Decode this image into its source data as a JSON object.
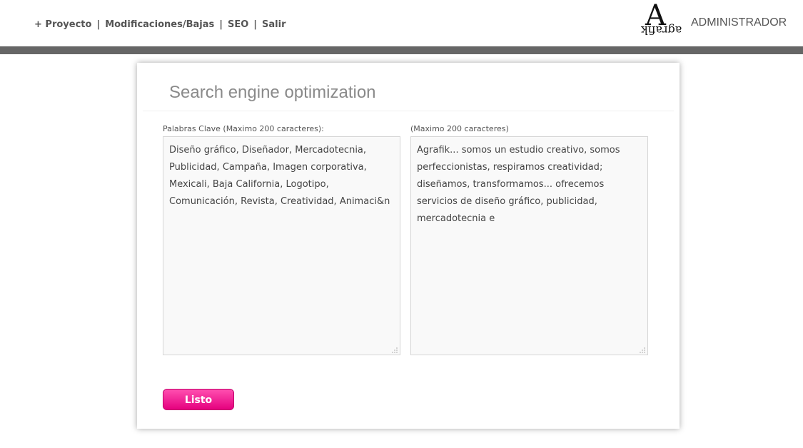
{
  "nav": {
    "items": [
      {
        "label": "+ Proyecto"
      },
      {
        "label": "Modificaciones/Bajas"
      },
      {
        "label": "SEO"
      },
      {
        "label": "Salir"
      }
    ],
    "separator": "|"
  },
  "brand": {
    "logo_letter": "A",
    "logo_word": "agrafik",
    "admin_label": "ADMINISTRADOR"
  },
  "colors": {
    "band": "#666666",
    "button": "#e5007e"
  },
  "form": {
    "title": "Search engine optimization",
    "keywords": {
      "label": "Palabras Clave (Maximo 200 caracteres):",
      "value": "Diseño gráfico, Diseñador, Mercadotecnia, Publicidad, Campaña, Imagen corporativa, Mexicali, Baja California, Logotipo, Comunicación, Revista, Creatividad, Animaci&n"
    },
    "description": {
      "label": "(Maximo 200 caracteres)",
      "value": "Agrafik... somos un estudio creativo, somos perfeccionistas, respiramos creatividad; diseñamos, transformamos... ofrecemos servicios de diseño gráfico, publicidad, mercadotecnia e"
    },
    "submit_label": "Listo"
  }
}
